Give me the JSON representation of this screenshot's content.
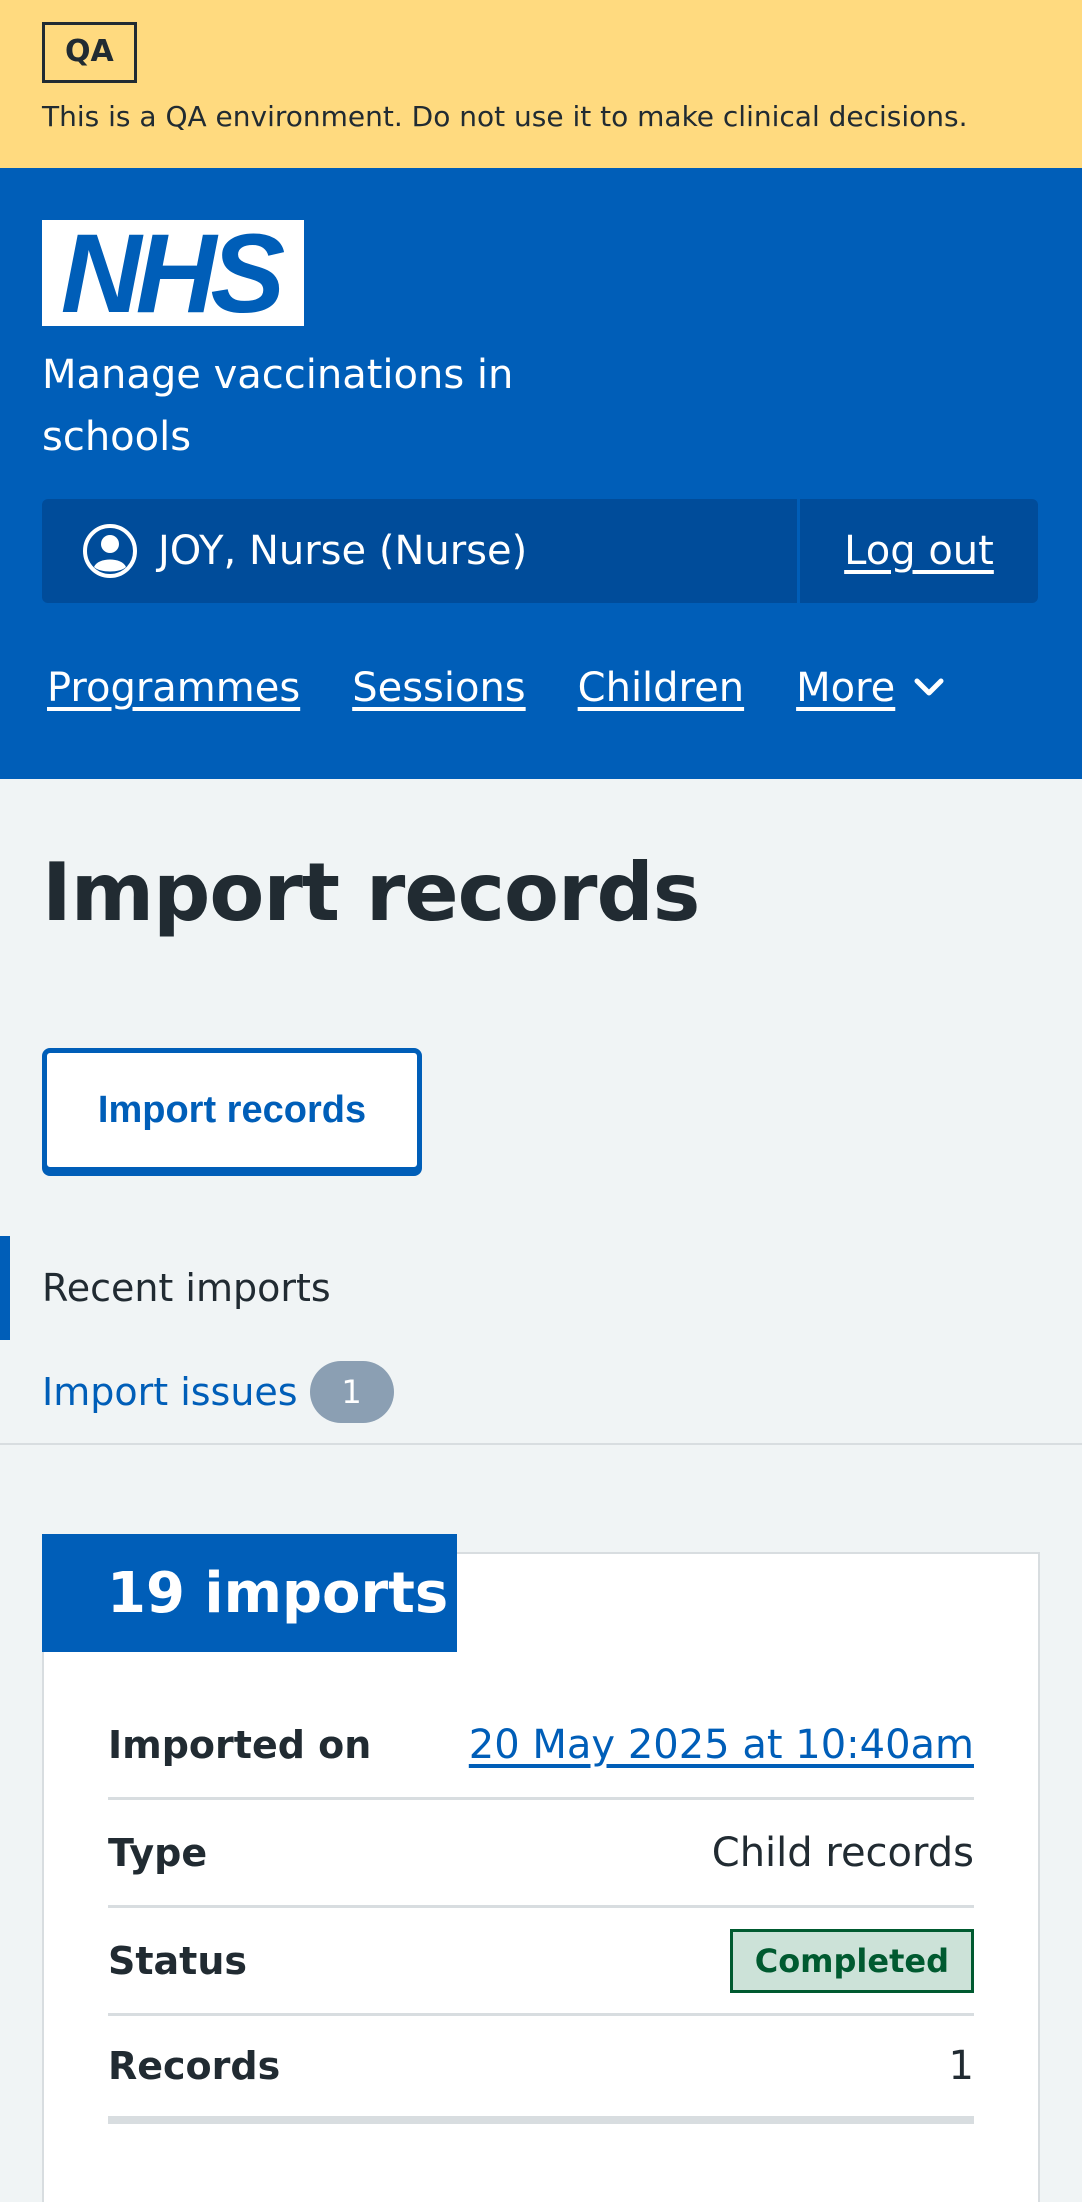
{
  "qa_banner": {
    "tag": "QA",
    "message": "This is a QA environment. Do not use it to make clinical decisions."
  },
  "header": {
    "logo_text": "NHS",
    "service_name": "Manage vaccinations in schools",
    "account": {
      "user": "JOY, Nurse (Nurse)",
      "logout": "Log out"
    },
    "nav": [
      "Programmes",
      "Sessions",
      "Children",
      "More"
    ]
  },
  "main": {
    "title": "Import records",
    "import_button": "Import records",
    "secondary_nav": {
      "current": "Recent imports",
      "issues_label": "Import issues",
      "issues_count": "1"
    },
    "card": {
      "heading": "19 imports",
      "rows": [
        {
          "key": "Imported on",
          "value": "20 May 2025 at 10:40am"
        },
        {
          "key": "Type",
          "value": "Child records"
        },
        {
          "key": "Status",
          "value": "Completed"
        },
        {
          "key": "Records",
          "value": "1"
        }
      ]
    }
  },
  "colors": {
    "nhs_blue": "#005eb8",
    "qa_yellow": "#ffda7f",
    "page_bg": "#f0f4f5",
    "success_green": "#005a30"
  }
}
